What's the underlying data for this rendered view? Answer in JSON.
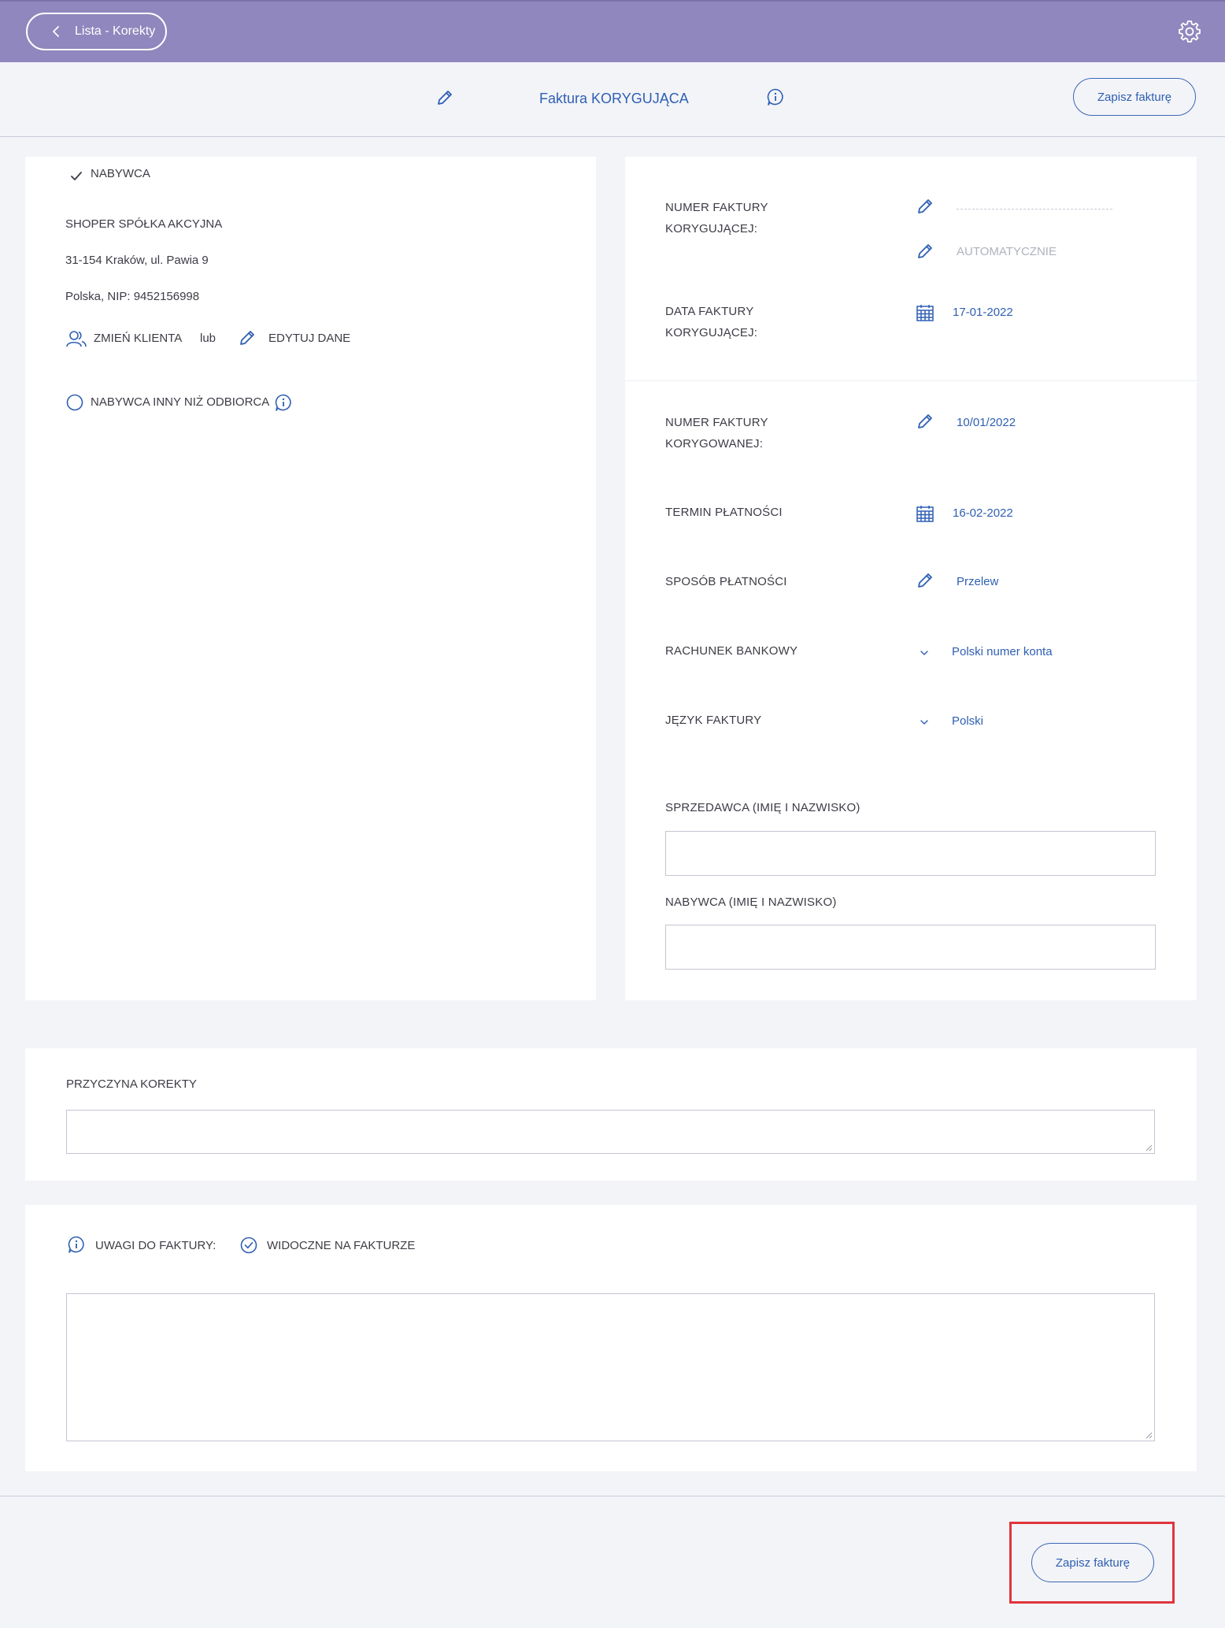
{
  "topbar": {
    "back_label": "Lista - Korekty"
  },
  "header": {
    "title": "Faktura KORYGUJĄCA",
    "save_label": "Zapisz fakturę"
  },
  "buyer": {
    "section_label": "NABYWCA",
    "name": "SHOPER SPÓŁKA AKCYJNA",
    "address": "31-154 Kraków, ul. Pawia 9",
    "country_nip": "Polska, NIP: 9452156998",
    "change_client": "ZMIEŃ KLIENTA",
    "or": "lub",
    "edit_data": "EDYTUJ DANE",
    "other_than_recipient": "NABYWCA INNY NIŻ ODBIORCA"
  },
  "details": {
    "correction_number_label_1": "NUMER FAKTURY",
    "correction_number_label_2": "KORYGUJĄCEJ:",
    "correction_number_auto": "AUTOMATYCZNIE",
    "correction_date_label_1": "DATA FAKTURY",
    "correction_date_label_2": "KORYGUJĄCEJ:",
    "correction_date_value": "17-01-2022",
    "corrected_number_label_1": "NUMER FAKTURY",
    "corrected_number_label_2": "KORYGOWANEJ:",
    "corrected_number_value": "10/01/2022",
    "payment_term_label": "TERMIN PŁATNOŚCI",
    "payment_term_value": "16-02-2022",
    "payment_method_label": "SPOSÓB PŁATNOŚCI",
    "payment_method_value": "Przelew",
    "bank_account_label": "RACHUNEK BANKOWY",
    "bank_account_value": "Polski numer konta",
    "language_label": "JĘZYK FAKTURY",
    "language_value": "Polski",
    "seller_label": "SPRZEDAWCA (IMIĘ I NAZWISKO)",
    "seller_value": "",
    "buyer_person_label": "NABYWCA (IMIĘ I NAZWISKO)",
    "buyer_person_value": ""
  },
  "reason": {
    "label": "PRZYCZYNA KOREKTY",
    "value": ""
  },
  "notes": {
    "label": "UWAGI DO FAKTURY:",
    "visible_label": "WIDOCZNE NA FAKTURZE",
    "value": ""
  },
  "footer": {
    "save_label": "Zapisz fakturę"
  },
  "colors": {
    "topbar": "#8f87bd",
    "accent": "#2f5fb3",
    "background": "#f3f4f8",
    "highlight": "#e0353c"
  }
}
